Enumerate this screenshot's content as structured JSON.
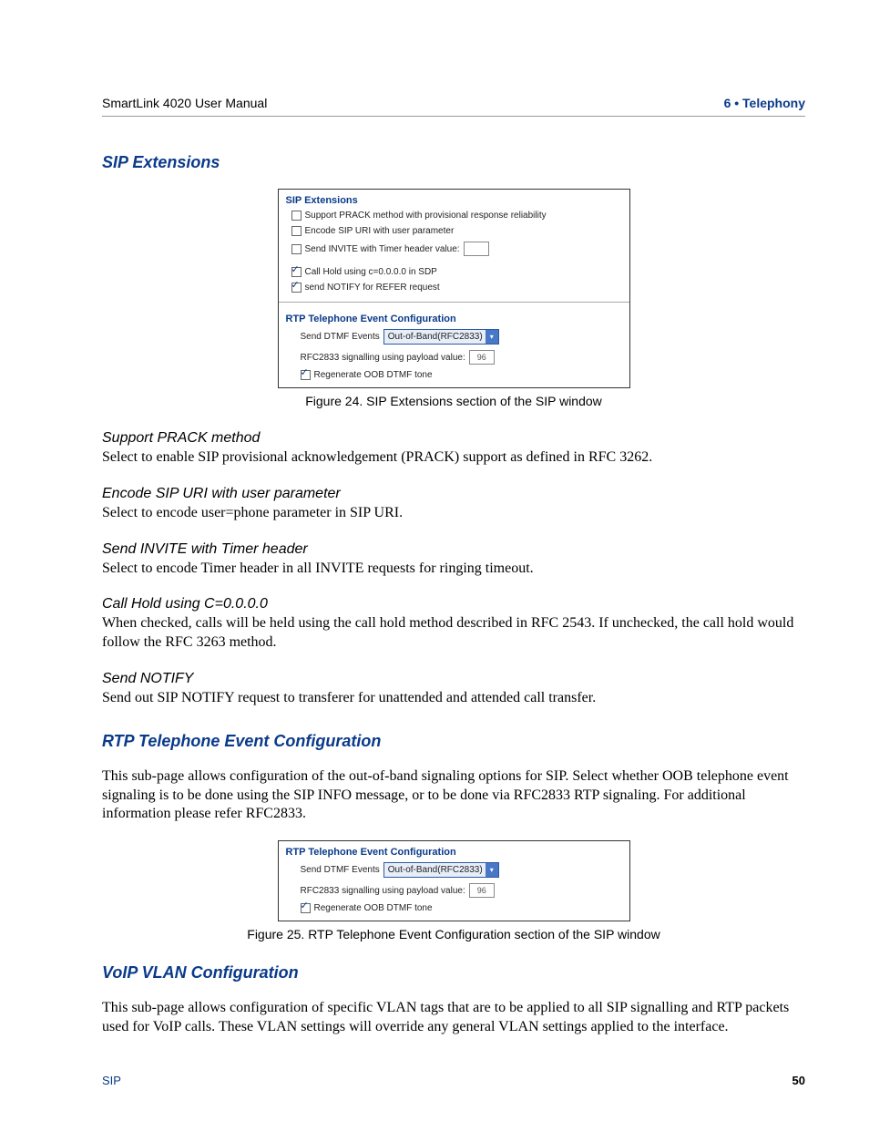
{
  "header": {
    "left": "SmartLink 4020 User Manual",
    "right": "6 • Telephony"
  },
  "section1_title": "SIP Extensions",
  "figure24": {
    "caption": "Figure 24. SIP Extensions section of the SIP window",
    "sip_ext_title": "SIP Extensions",
    "opt1": "Support PRACK method with provisional response reliability",
    "opt2": "Encode SIP URI with user parameter",
    "opt3_label": "Send INVITE with Timer header value:",
    "opt3_value": "",
    "opt4": "Call Hold using c=0.0.0.0 in SDP",
    "opt5": "send NOTIFY for REFER request",
    "rtp_title": "RTP Telephone Event Configuration",
    "rtp_send_label": "Send DTMF Events",
    "rtp_send_value": "Out-of-Band(RFC2833)",
    "rtp_payload_label": "RFC2833 signalling using payload value:",
    "rtp_payload_value": "96",
    "rtp_regen": "Regenerate OOB DTMF tone"
  },
  "subs": {
    "prack_h": "Support PRACK method",
    "prack_b": "Select to enable SIP provisional acknowledgement (PRACK) support as defined in RFC 3262.",
    "encode_h": "Encode SIP URI with user parameter",
    "encode_b": "Select to encode user=phone parameter in SIP URI.",
    "invite_h": "Send INVITE with Timer header",
    "invite_b": "Select to encode Timer header in all INVITE requests for ringing timeout.",
    "hold_h": "Call Hold using C=0.0.0.0",
    "hold_b": "When checked, calls will be held using the call hold method described in RFC 2543. If unchecked, the call hold would follow the RFC 3263 method.",
    "notify_h": "Send NOTIFY",
    "notify_b": "Send out SIP NOTIFY request to transferer for unattended and attended call transfer."
  },
  "section2_title": "RTP Telephone Event Configuration",
  "section2_body": "This sub-page allows configuration of the out-of-band signaling options for SIP. Select whether OOB telephone event signaling is to be done using the SIP INFO message, or to be done via RFC2833 RTP signaling. For additional information please refer RFC2833.",
  "figure25": {
    "caption": "Figure 25. RTP Telephone Event Configuration section of the SIP window",
    "rtp_title": "RTP Telephone Event Configuration",
    "rtp_send_label": "Send DTMF Events",
    "rtp_send_value": "Out-of-Band(RFC2833)",
    "rtp_payload_label": "RFC2833 signalling using payload value:",
    "rtp_payload_value": "96",
    "rtp_regen": "Regenerate OOB DTMF tone"
  },
  "section3_title": "VoIP VLAN Configuration",
  "section3_body": "This sub-page allows configuration of specific VLAN tags that are to be applied to all SIP signalling and RTP packets used for VoIP calls. These VLAN settings will override any general VLAN settings applied to the interface.",
  "footer": {
    "left": "SIP",
    "right": "50"
  }
}
